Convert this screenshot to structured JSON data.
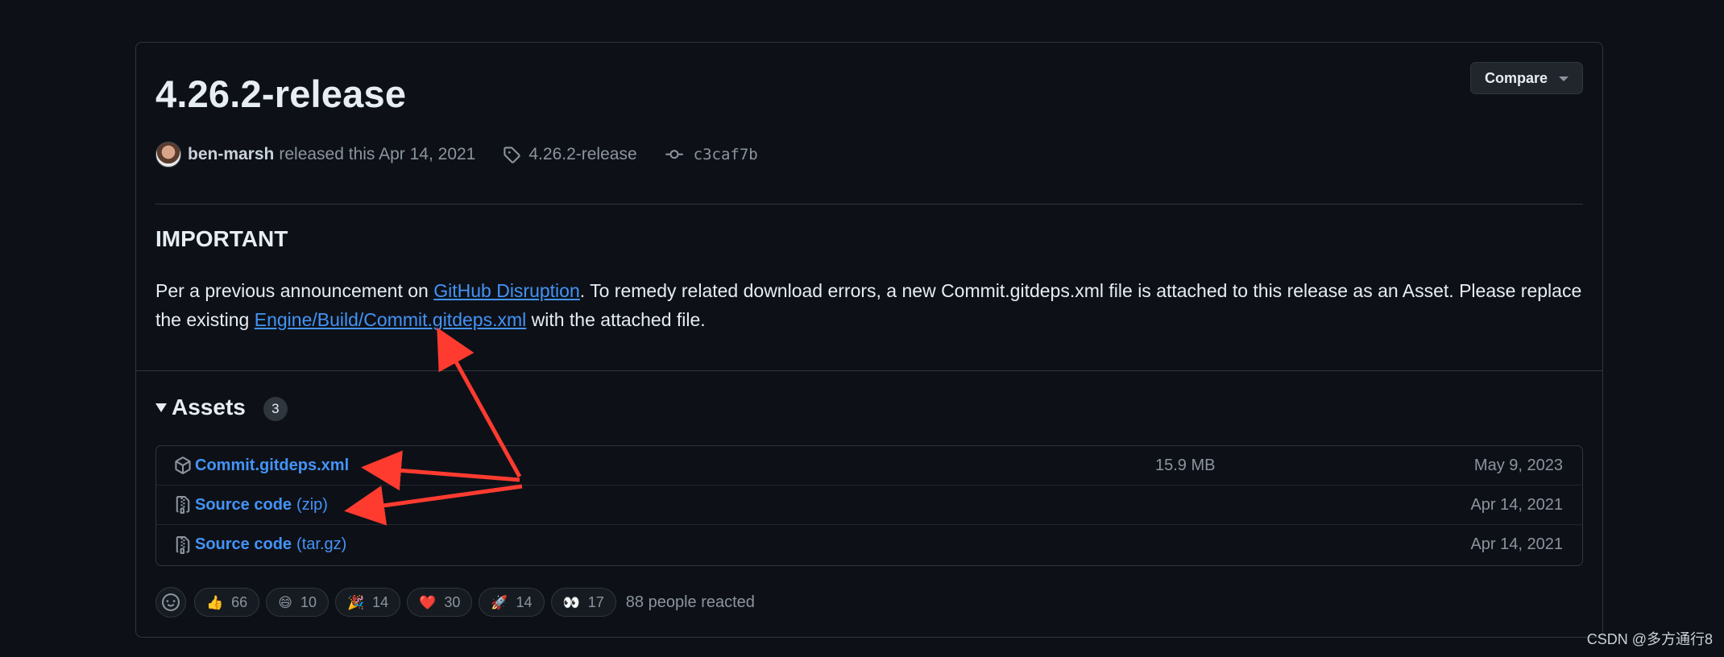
{
  "release": {
    "title": "4.26.2-release",
    "compare_label": "Compare",
    "author": "ben-marsh",
    "released_text": "released this Apr 14, 2021",
    "tag": "4.26.2-release",
    "commit": "c3caf7b"
  },
  "notes": {
    "heading": "IMPORTANT",
    "text_1": "Per a previous announcement on ",
    "link_1": "GitHub Disruption",
    "text_2": ". To remedy related download errors, a new Commit.gitdeps.xml file is attached to this release as an Asset. Please replace the existing ",
    "link_2": "Engine/Build/Commit.gitdeps.xml",
    "text_3": " with the attached file."
  },
  "assets": {
    "title": "Assets",
    "count": "3",
    "items": [
      {
        "icon": "package-icon",
        "name": "Commit.gitdeps.xml",
        "suffix": "",
        "size": "15.9 MB",
        "date": "May 9, 2023"
      },
      {
        "icon": "file-zip-icon",
        "name": "Source code",
        "suffix": "(zip)",
        "size": "",
        "date": "Apr 14, 2021"
      },
      {
        "icon": "file-zip-icon",
        "name": "Source code",
        "suffix": "(tar.gz)",
        "size": "",
        "date": "Apr 14, 2021"
      }
    ]
  },
  "reactions": {
    "items": [
      {
        "emoji": "👍",
        "name": "thumbs-up",
        "count": "66"
      },
      {
        "emoji": "😄",
        "name": "laugh",
        "count": "10"
      },
      {
        "emoji": "🎉",
        "name": "hooray",
        "count": "14"
      },
      {
        "emoji": "❤️",
        "name": "heart",
        "count": "30"
      },
      {
        "emoji": "🚀",
        "name": "rocket",
        "count": "14"
      },
      {
        "emoji": "👀",
        "name": "eyes",
        "count": "17"
      }
    ],
    "summary": "88 people reacted"
  },
  "watermark": "CSDN @多方通行8",
  "colors": {
    "background": "#0d1117",
    "border": "#30363d",
    "link": "#4493f8",
    "muted": "#8b949e",
    "annotation_arrow": "#ff3b30"
  }
}
